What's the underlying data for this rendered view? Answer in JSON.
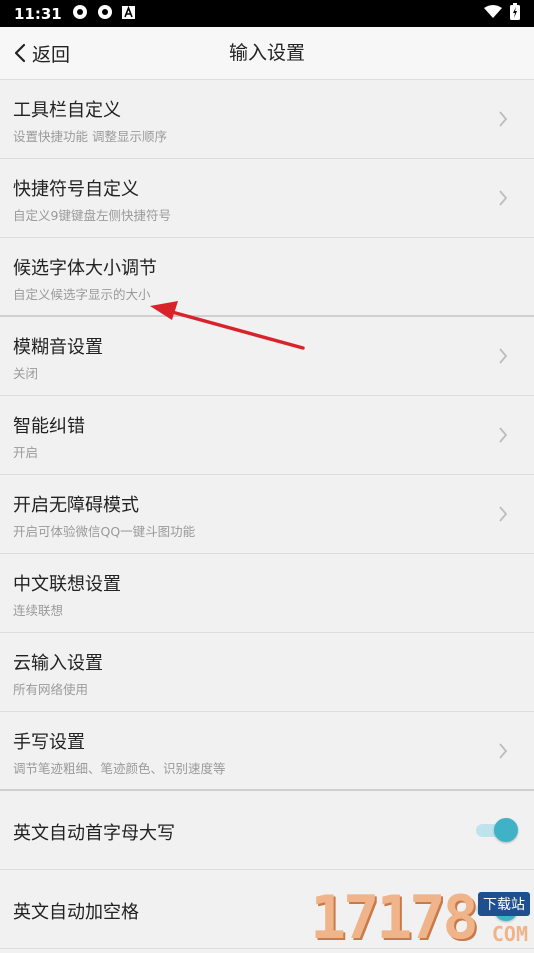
{
  "status": {
    "time": "11:31"
  },
  "header": {
    "back_label": "返回",
    "title": "输入设置"
  },
  "items": [
    {
      "title": "工具栏自定义",
      "subtitle": "设置快捷功能 调整显示顺序"
    },
    {
      "title": "快捷符号自定义",
      "subtitle": "自定义9键键盘左侧快捷符号"
    },
    {
      "title": "候选字体大小调节",
      "subtitle": "自定义候选字显示的大小"
    },
    {
      "title": "模糊音设置",
      "subtitle": "关闭"
    },
    {
      "title": "智能纠错",
      "subtitle": "开启"
    },
    {
      "title": "开启无障碍模式",
      "subtitle": "开启可体验微信QQ一键斗图功能"
    },
    {
      "title": "中文联想设置",
      "subtitle": "连续联想"
    },
    {
      "title": "云输入设置",
      "subtitle": "所有网络使用"
    },
    {
      "title": "手写设置",
      "subtitle": "调节笔迹粗细、笔迹颜色、识别速度等"
    },
    {
      "title": "英文自动首字母大写",
      "toggle_on": true
    },
    {
      "title": "英文自动加空格",
      "toggle_on": true
    }
  ],
  "watermark": {
    "number": "17178",
    "tag": "下载站",
    "suffix": "COM"
  },
  "colors": {
    "accent": "#3fb2c8",
    "annotation_arrow": "#d9232b"
  }
}
